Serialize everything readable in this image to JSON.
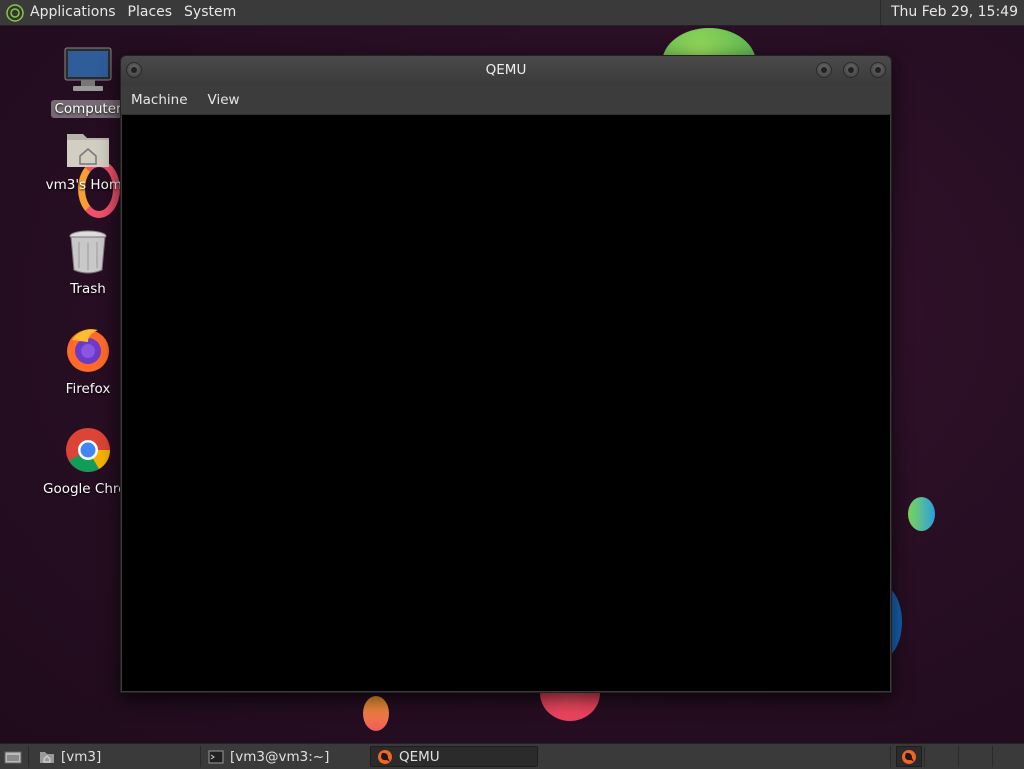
{
  "top_panel": {
    "menus": [
      "Applications",
      "Places",
      "System"
    ],
    "clock": "Thu Feb 29, 15:49"
  },
  "desktop": {
    "icons": [
      {
        "label": "Computer",
        "icon": "computer-icon",
        "selected": true
      },
      {
        "label": "vm3's Home",
        "icon": "home-folder-icon",
        "selected": false
      },
      {
        "label": "Trash",
        "icon": "trash-icon",
        "selected": false
      },
      {
        "label": "Firefox",
        "icon": "firefox-icon",
        "selected": false
      },
      {
        "label": "Google Chrome",
        "icon": "chrome-icon",
        "selected": false
      }
    ]
  },
  "window": {
    "title": "QEMU",
    "menu": [
      "Machine",
      "View"
    ]
  },
  "taskbar": {
    "items": [
      {
        "label": "[vm3]",
        "icon": "folder-icon",
        "active": false
      },
      {
        "label": "[vm3@vm3:~]",
        "icon": "terminal-icon",
        "active": false
      },
      {
        "label": "QEMU",
        "icon": "qemu-icon",
        "active": true
      }
    ]
  },
  "colors": {
    "panel": "#3a3a3a",
    "wallpaper": "#2a0f25",
    "screen": "#000000"
  }
}
